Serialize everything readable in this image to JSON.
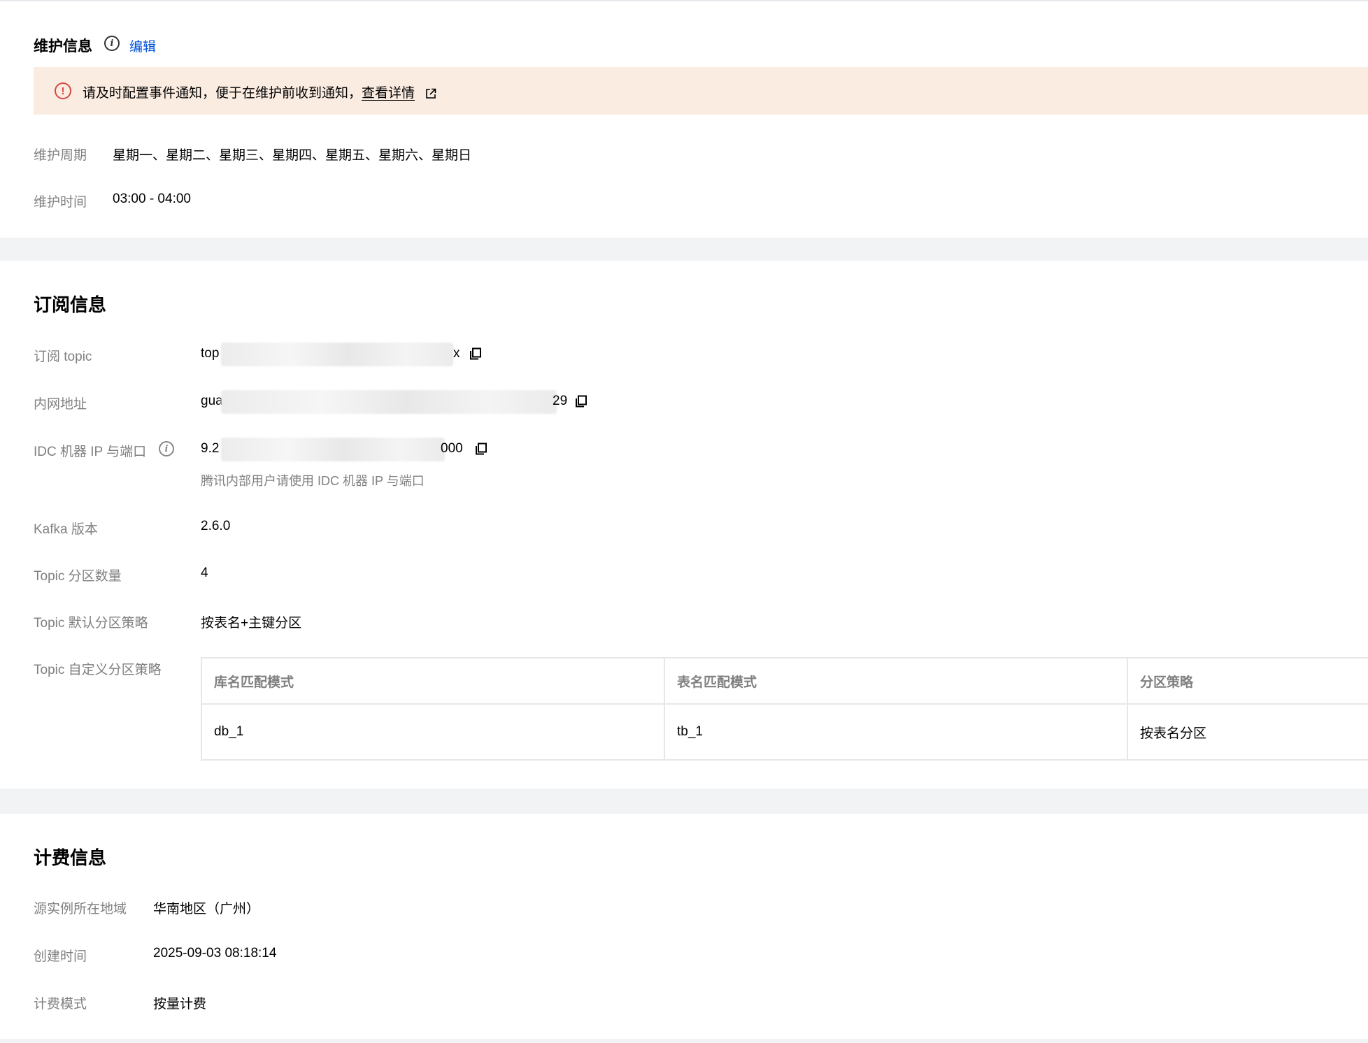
{
  "maintenance": {
    "title": "维护信息",
    "edit_label": "编辑",
    "alert": {
      "text": "请及时配置事件通知，便于在维护前收到通知，",
      "link": "查看详情"
    },
    "period_label": "维护周期",
    "period_value": "星期一、星期二、星期三、星期四、星期五、星期六、星期日",
    "time_label": "维护时间",
    "time_value": "03:00 - 04:00"
  },
  "subscription": {
    "title": "订阅信息",
    "topic_label": "订阅 topic",
    "topic_prefix": "top",
    "topic_suffix": "x",
    "intranet_label": "内网地址",
    "intranet_prefix": "gua",
    "intranet_suffix": "29",
    "idc_label": "IDC 机器 IP 与端口",
    "idc_prefix": "9.2",
    "idc_suffix": "000",
    "idc_help": "腾讯内部用户请使用 IDC 机器 IP 与端口",
    "kafka_label": "Kafka 版本",
    "kafka_value": "2.6.0",
    "partition_count_label": "Topic 分区数量",
    "partition_count_value": "4",
    "default_strategy_label": "Topic 默认分区策略",
    "default_strategy_value": "按表名+主键分区",
    "custom_strategy_label": "Topic 自定义分区策略",
    "table": {
      "headers": [
        "库名匹配模式",
        "表名匹配模式",
        "分区策略"
      ],
      "rows": [
        [
          "db_1",
          "tb_1",
          "按表名分区"
        ]
      ]
    }
  },
  "billing": {
    "title": "计费信息",
    "region_label": "源实例所在地域",
    "region_value": "华南地区（广州）",
    "created_label": "创建时间",
    "created_value": "2025-09-03 08:18:14",
    "mode_label": "计费模式",
    "mode_value": "按量计费"
  }
}
